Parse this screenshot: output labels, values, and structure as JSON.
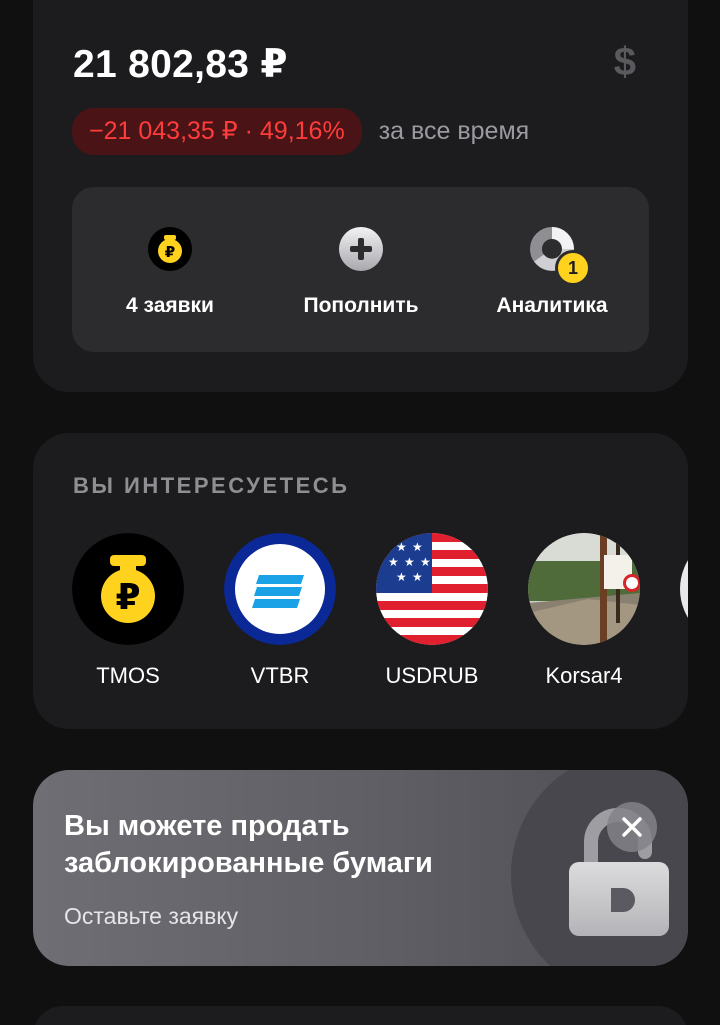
{
  "portfolio": {
    "balance": "21 802,83 ₽",
    "currency_symbol": "$",
    "change": "−21 043,35 ₽ · 49,16%",
    "change_period": "за все время",
    "actions": [
      {
        "label": "4 заявки",
        "icon": "ruble-bag-icon"
      },
      {
        "label": "Пополнить",
        "icon": "plus-circle-icon"
      },
      {
        "label": "Аналитика",
        "icon": "donut-chart-icon",
        "badge": "1"
      }
    ]
  },
  "interests": {
    "title": "ВЫ ИНТЕРЕСУЕТЕСЬ",
    "tickers": [
      {
        "name": "TMOS",
        "icon": "ruble-bag-icon"
      },
      {
        "name": "VTBR",
        "icon": "vtb-logo-icon"
      },
      {
        "name": "USDRUB",
        "icon": "us-flag-icon"
      },
      {
        "name": "Korsar4",
        "icon": "user-photo-avatar"
      }
    ]
  },
  "promo": {
    "title": "Вы можете продать заблокированные бумаги",
    "subtitle": "Оставьте заявку"
  },
  "colors": {
    "background": "#101010",
    "card": "#1c1c1e",
    "panel": "#2c2c2e",
    "negative": "#ff3b3b",
    "negative_bg": "#4a1416",
    "accent_yellow": "#ffd21e",
    "vtb_blue": "#0a2896"
  }
}
